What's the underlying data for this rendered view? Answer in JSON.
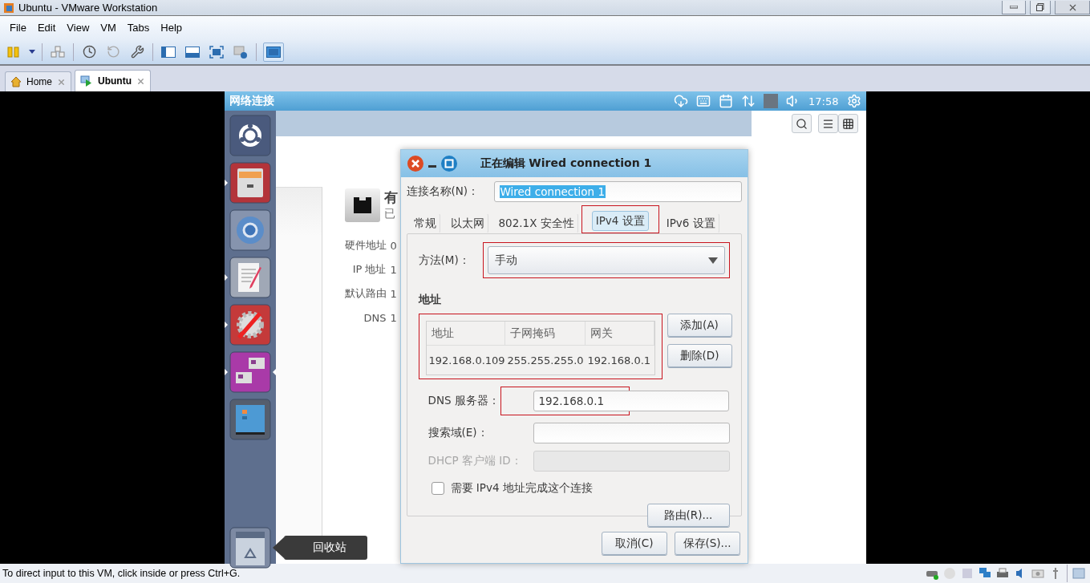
{
  "window": {
    "title": "Ubuntu - VMware Workstation"
  },
  "menu": [
    "File",
    "Edit",
    "View",
    "VM",
    "Tabs",
    "Help"
  ],
  "toolbar": {
    "console_view_pressed": true
  },
  "tabs": [
    {
      "label": "Home",
      "selected": false
    },
    {
      "label": "Ubuntu",
      "selected": true
    }
  ],
  "guest": {
    "panel": {
      "title": "网络连接",
      "time": "17:58"
    },
    "launcher": [
      {
        "kind": "dash",
        "running": false,
        "focused": false
      },
      {
        "kind": "files",
        "running": true,
        "focused": false
      },
      {
        "kind": "browser",
        "running": false,
        "focused": false
      },
      {
        "kind": "editor",
        "running": true,
        "focused": false
      },
      {
        "kind": "settings",
        "running": true,
        "focused": false
      },
      {
        "kind": "remote",
        "running": true,
        "focused": true
      },
      {
        "kind": "workspaces",
        "running": false,
        "focused": false
      },
      {
        "kind": "trash",
        "running": false,
        "focused": false
      }
    ],
    "launcher_tooltip": "回收站",
    "background_window": {
      "device_name": "有",
      "device_status": "已",
      "details": [
        {
          "label": "硬件地址",
          "value": "0"
        },
        {
          "label": "IP 地址",
          "value": "1"
        },
        {
          "label": "默认路由",
          "value": "1"
        },
        {
          "label": "DNS",
          "value": "1"
        }
      ]
    },
    "dialog": {
      "title": "正在编辑 Wired connection 1",
      "name_label": "连接名称(N)：",
      "name_value": "Wired connection 1",
      "tabs": [
        {
          "label": "常规",
          "selected": false,
          "highlighted": false
        },
        {
          "label": "以太网",
          "selected": false,
          "highlighted": false
        },
        {
          "label": "802.1X 安全性",
          "selected": false,
          "highlighted": false
        },
        {
          "label": "IPv4 设置",
          "selected": true,
          "highlighted": true
        },
        {
          "label": "IPv6 设置",
          "selected": false,
          "highlighted": false
        }
      ],
      "method": {
        "label": "方法(M)：",
        "value": "手动",
        "highlighted": true
      },
      "addresses": {
        "heading": "地址",
        "highlighted": true,
        "columns": [
          "地址",
          "子网掩码",
          "网关"
        ],
        "rows": [
          [
            "192.168.0.109",
            "255.255.255.0",
            "192.168.0.1"
          ]
        ],
        "add_button": "添加(A)",
        "delete_button": "删除(D)"
      },
      "fields": [
        {
          "label": "DNS 服务器：",
          "value": "192.168.0.1",
          "disabled": false,
          "highlighted": true
        },
        {
          "label": "搜索域(E)：",
          "disabled": false,
          "highlighted": false
        },
        {
          "label": "DHCP 客户端 ID：",
          "disabled": true,
          "highlighted": false
        }
      ],
      "require_ipv4": {
        "label": "需要 IPv4 地址完成这个连接",
        "checked": false
      },
      "routes_button": "路由(R)...",
      "buttons": [
        "取消(C)",
        "保存(S)..."
      ]
    }
  },
  "status_bar": {
    "text": "To direct input to this VM, click inside or press Ctrl+G."
  }
}
